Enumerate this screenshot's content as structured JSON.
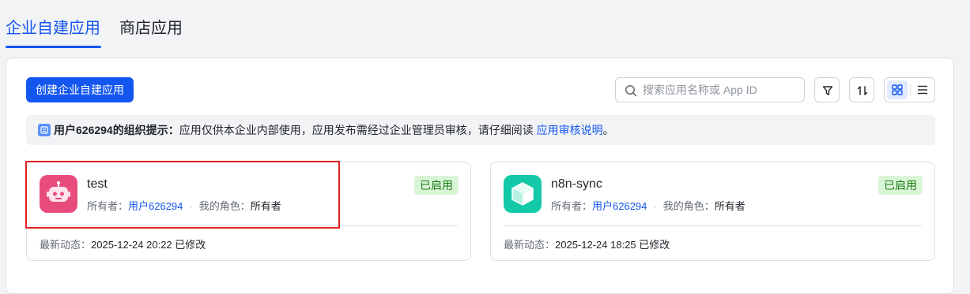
{
  "tabs": [
    {
      "label": "企业自建应用",
      "active": true
    },
    {
      "label": "商店应用",
      "active": false
    }
  ],
  "toolbar": {
    "create_label": "创建企业自建应用",
    "search_placeholder": "搜索应用名称或 App ID"
  },
  "notice": {
    "title": "用户626294的组织提示：",
    "body": "应用仅供本企业内部使用，应用发布需经过企业管理员审核，请仔细阅读",
    "link": "应用审核说明",
    "end": "。"
  },
  "apps": [
    {
      "name": "test",
      "owner_label": "所有者：",
      "owner": "用户626294",
      "role_label": "我的角色：",
      "role": "所有者",
      "status": "已启用",
      "update_label": "最新动态：",
      "update": "2025-12-24 20:22 已修改",
      "icon": "robot-icon",
      "icon_color": "#e84c7d"
    },
    {
      "name": "n8n-sync",
      "owner_label": "所有者：",
      "owner": "用户626294",
      "role_label": "我的角色：",
      "role": "所有者",
      "status": "已启用",
      "update_label": "最新动态：",
      "update": "2025-12-24 18:25 已修改",
      "icon": "cube-icon",
      "icon_color": "#14c9a8"
    }
  ],
  "colors": {
    "accent": "#1456f0",
    "status_bg": "#d9f5d6",
    "status_text": "#1a7a14",
    "highlight": "#e02020"
  }
}
